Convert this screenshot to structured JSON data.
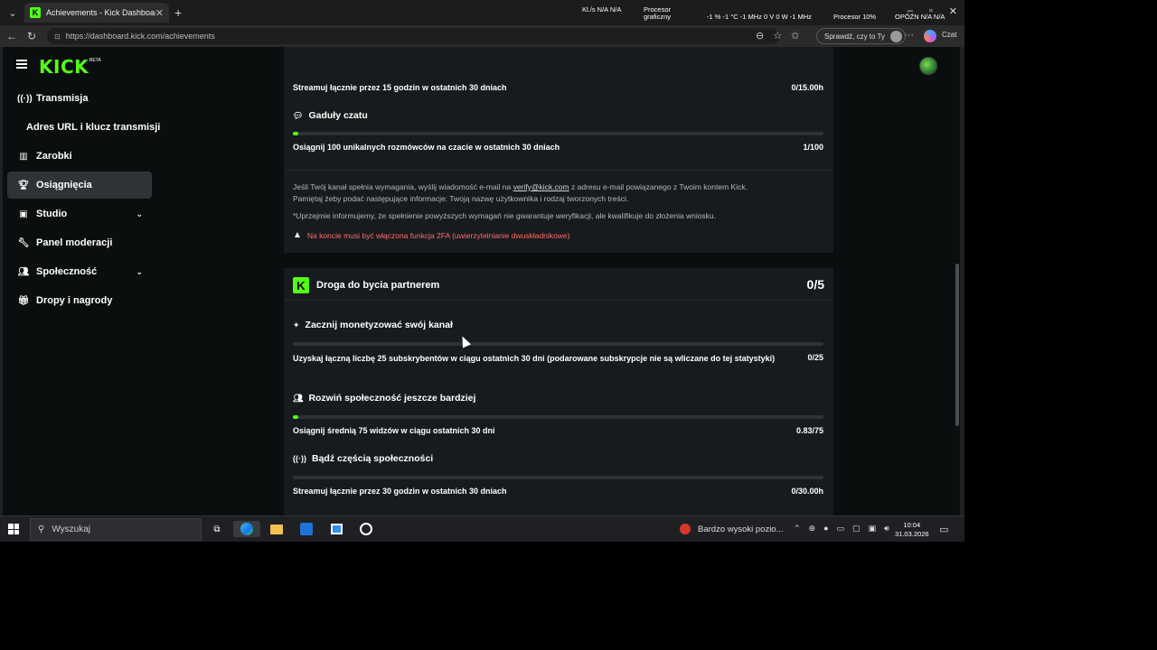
{
  "browser": {
    "tab_title": "Achievements - Kick Dashboard",
    "url": "https://dashboard.kick.com/achievements",
    "sprawdz_label": "Sprawdź, czy to Ty",
    "czat_label": "Czat",
    "hud": {
      "net": "Kl./s  N/A   N/A",
      "gpu_label_1": "Procesor",
      "gpu_label_2": "graficzny",
      "gpu_values": "-1 %  -1 °C  -1 MHz   0 V   0 W   -1 MHz",
      "cpu": "Procesor  10%",
      "delay": "OPÓŹN  N/A   N/A"
    }
  },
  "app": {
    "logo": "KICK",
    "beta": "BETA"
  },
  "sidebar": {
    "items": [
      {
        "label": "Transmisja",
        "icon": "broadcast-icon"
      },
      {
        "label": "Adres URL i klucz transmisji"
      },
      {
        "label": "Zarobki",
        "icon": "chart-icon"
      },
      {
        "label": "Osiągnięcia",
        "icon": "trophy-icon",
        "active": true
      },
      {
        "label": "Studio",
        "icon": "studio-icon",
        "expandable": true
      },
      {
        "label": "Panel moderacji",
        "icon": "wrench-icon"
      },
      {
        "label": "Społeczność",
        "icon": "community-icon",
        "expandable": true
      },
      {
        "label": "Dropy i nagrody",
        "icon": "gift-icon"
      }
    ]
  },
  "verification_card": {
    "stream_req_label": "Streamuj łącznie przez 15 godzin w ostatnich 30 dniach",
    "stream_req_value": "0/15.00h",
    "chat_section_title": "Gaduły czatu",
    "chat_req_label": "Osiągnij 100 unikalnych rozmówców na czacie w ostatnich 30 dniach",
    "chat_req_value": "1/100",
    "chat_progress": 0.01,
    "info_line1_pre": "Jeśli Twój kanał spełnia wymagania, wyślij wiadomość e-mail na ",
    "info_email": "verify@kick.com",
    "info_line1_post": " z adresu e-mail powiązanego z Twoim kontem Kick.",
    "info_line2": "Pamiętaj żeby podać następujące informacje: Twoją nazwę użytkownika i rodzaj tworzonych treści.",
    "info_note": "*Uprzejmie informujemy, że spełnienie powyższych wymagań nie gwarantuje weryfikacji, ale kwalifikuje do złożenia wniosku.",
    "warning": "Na koncie musi być włączona funkcja 2FA (uwierzytelnianie dwuskładnikowe)"
  },
  "partner_card": {
    "title": "Droga do bycia partnerem",
    "count": "0/5",
    "sections": [
      {
        "title": "Zacznij monetyzować swój kanał",
        "icon": "sparkle-icon",
        "req_label": "Uzyskaj łączną liczbę 25 subskrybentów w ciągu ostatnich 30 dni (podarowane subskrypcje nie są wliczane do tej statystyki)",
        "req_value": "0/25",
        "progress": 0
      },
      {
        "title": "Rozwiń społeczność jeszcze bardziej",
        "icon": "community-icon",
        "req_label": "Osiągnij średnią 75 widzów w ciągu ostatnich 30 dni",
        "req_value": "0.83/75",
        "progress": 0.011
      },
      {
        "title": "Bądź częścią społeczności",
        "icon": "broadcast-icon",
        "req_label": "Streamuj łącznie przez 30 godzin w ostatnich 30 dniach",
        "req_value": "0/30.00h",
        "progress": 0
      }
    ]
  },
  "taskbar": {
    "search_placeholder": "Wyszukaj",
    "tray_app_label": "Bardzo wysoki pozio...",
    "time": "10:04",
    "date": "31.03.2026"
  },
  "colors": {
    "accent": "#53fc18",
    "warning": "#ff6b6b"
  }
}
